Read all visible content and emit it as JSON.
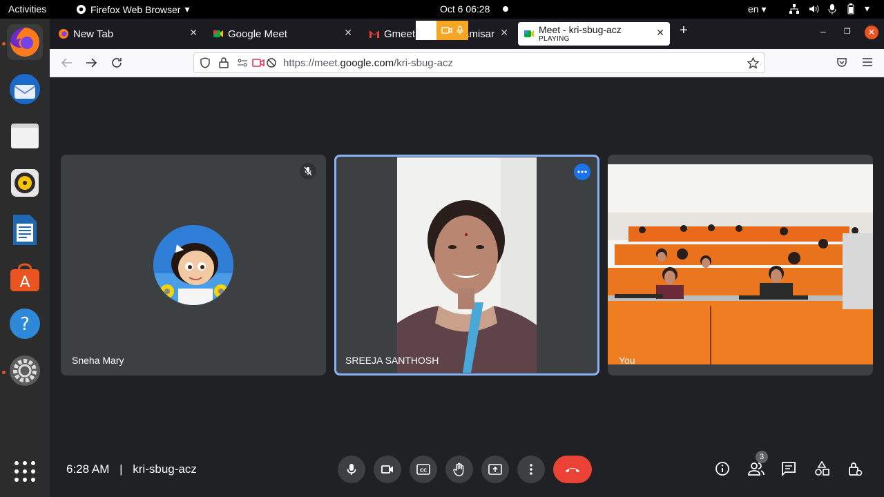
{
  "topbar": {
    "activities": "Activities",
    "app_name": "Firefox Web Browser",
    "clock": "Oct 6  06:28",
    "language": "en"
  },
  "dock": {
    "items": [
      "firefox-icon",
      "thunderbird-icon",
      "files-icon",
      "rhythmbox-icon",
      "writer-icon",
      "software-icon",
      "help-icon",
      "settings-icon",
      "app-grid-icon"
    ]
  },
  "browser": {
    "tabs": [
      {
        "title": "New Tab"
      },
      {
        "title": "Google Meet"
      },
      {
        "title": "Gmeet"
      },
      {
        "title": "amisar"
      },
      {
        "title": "Meet - kri-sbug-acz",
        "sub": "PLAYING"
      }
    ],
    "url_prefix": "https://meet.",
    "url_domain": "google.com",
    "url_path": "/kri-sbug-acz"
  },
  "meet": {
    "participants": [
      {
        "name": "Sneha Mary"
      },
      {
        "name": "SREEJA SANTHOSH"
      },
      {
        "name": "You"
      }
    ],
    "time": "6:28 AM",
    "separator": "|",
    "meeting_code": "kri-sbug-acz",
    "participant_count": "3"
  },
  "colors": {
    "meet_bg": "#202124",
    "tile_bg": "#3c4043",
    "end_call": "#ea4335",
    "speaking_border": "#8ab4f8",
    "ubuntu_accent": "#e95420"
  }
}
